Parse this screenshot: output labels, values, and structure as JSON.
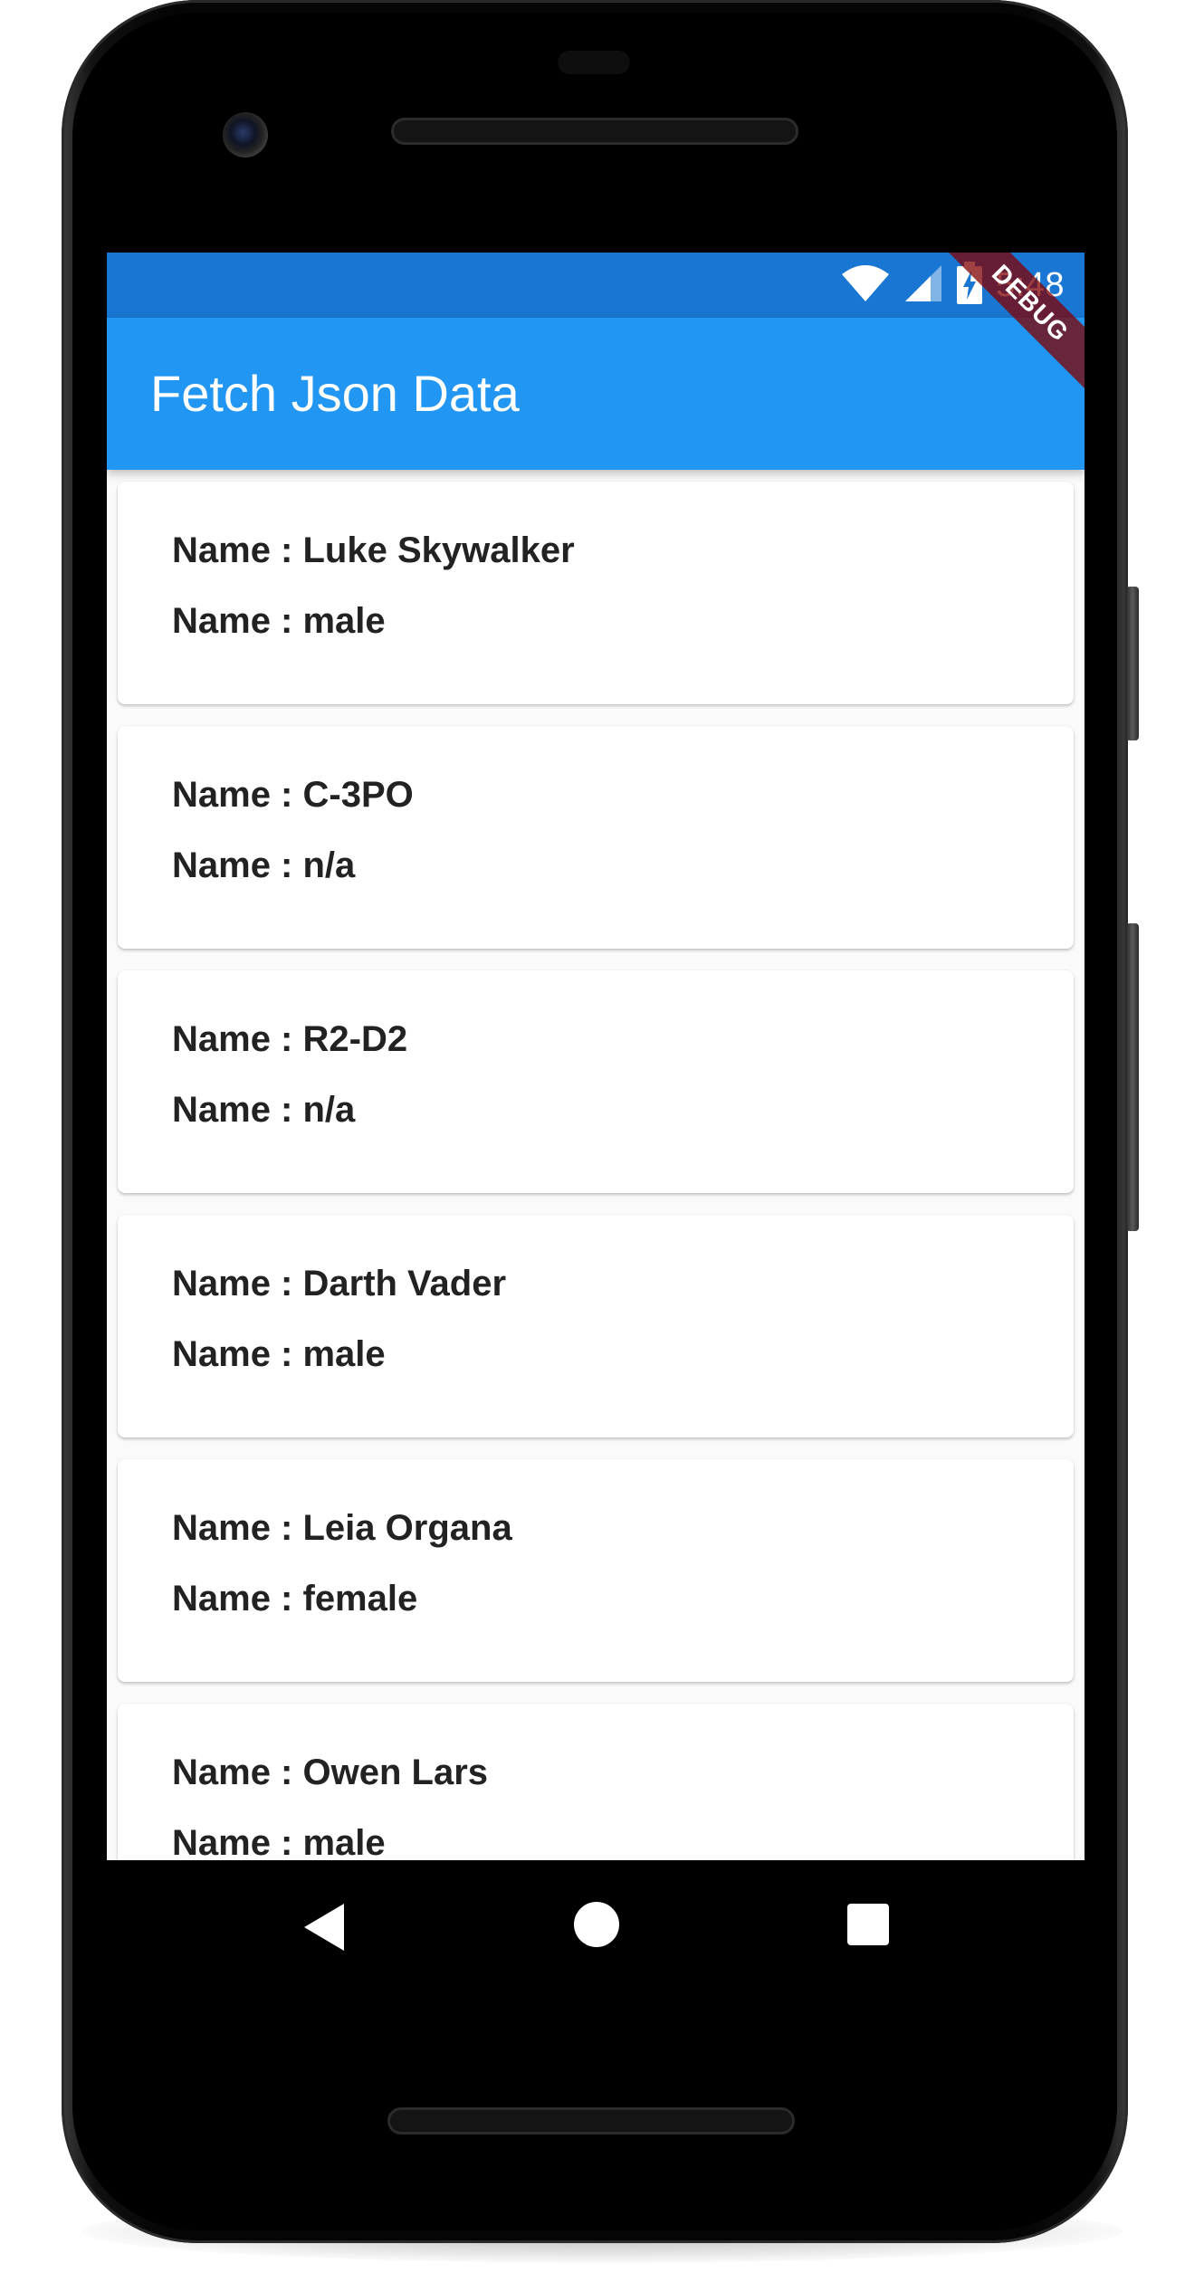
{
  "status_bar": {
    "time": "5:48",
    "color": "#1976d2"
  },
  "app_bar": {
    "title": "Fetch Json Data",
    "color": "#2196f3"
  },
  "debug_banner": "DEBUG",
  "cards": [
    {
      "line1": "Name : Luke Skywalker",
      "line2": "Name : male"
    },
    {
      "line1": "Name : C-3PO",
      "line2": "Name : n/a"
    },
    {
      "line1": "Name : R2-D2",
      "line2": "Name : n/a"
    },
    {
      "line1": "Name : Darth Vader",
      "line2": "Name : male"
    },
    {
      "line1": "Name : Leia Organa",
      "line2": "Name : female"
    },
    {
      "line1": "Name : Owen Lars",
      "line2": "Name : male"
    }
  ],
  "icons": {
    "wifi": "wifi-icon",
    "signal": "cellular-signal-icon",
    "battery": "battery-charging-icon",
    "back": "back-triangle-icon",
    "home": "home-circle-icon",
    "recents": "recents-square-icon"
  }
}
